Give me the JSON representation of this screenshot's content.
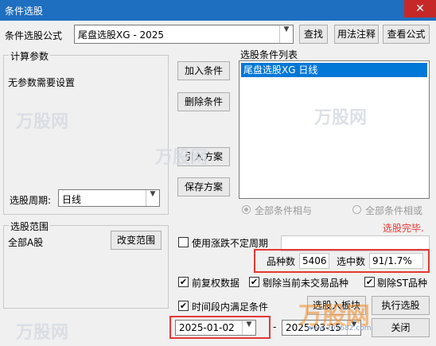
{
  "window": {
    "title": "条件选股",
    "close_glyph": "✕"
  },
  "formula": {
    "label": "条件选股公式",
    "value": "尾盘选股XG  -  2025",
    "find_button": "查找",
    "usage_button": "用法注释",
    "view_button": "查看公式"
  },
  "params": {
    "legend": "计算参数",
    "empty_text": "无参数需要设置",
    "period_label": "选股周期:",
    "period_value": "日线"
  },
  "actions": {
    "add": "加入条件",
    "delete": "删除条件",
    "import": "引入方案",
    "save": "保存方案"
  },
  "conditions": {
    "legend": "选股条件列表",
    "items": [
      "尾盘选股XG  日线"
    ],
    "radio_and": "全部条件相与",
    "radio_or": "全部条件相或",
    "status": "选股完毕."
  },
  "scope": {
    "legend": "选股范围",
    "value": "全部A股",
    "change_button": "改变范围"
  },
  "options": {
    "use_limit_label": "使用涨跌不定周期",
    "variety_label": "品种数",
    "variety_value": "5406",
    "selected_label": "选中数",
    "selected_value": "91/1.7%",
    "fq_label": "前复权数据",
    "fq_checked": true,
    "exclude_untraded_label": "剔除当前未交易品种",
    "exclude_untraded_checked": true,
    "exclude_st_label": "剔除ST品种",
    "exclude_st_checked": true,
    "period_satisfy_label": "时间段内满足条件",
    "period_satisfy_checked": true,
    "start_date": "2025-01-02",
    "end_date": "2025-03-15",
    "range_sep": "-"
  },
  "bottom": {
    "select_to_block": "选股入板块",
    "run_button": "执行选股",
    "close_button": "关闭"
  },
  "watermark": {
    "brand": "万股网",
    "url": "www.201682.com"
  },
  "colors": {
    "accent": "#0078d7",
    "title": "#1e6fbf",
    "highlight": "#e53935"
  }
}
